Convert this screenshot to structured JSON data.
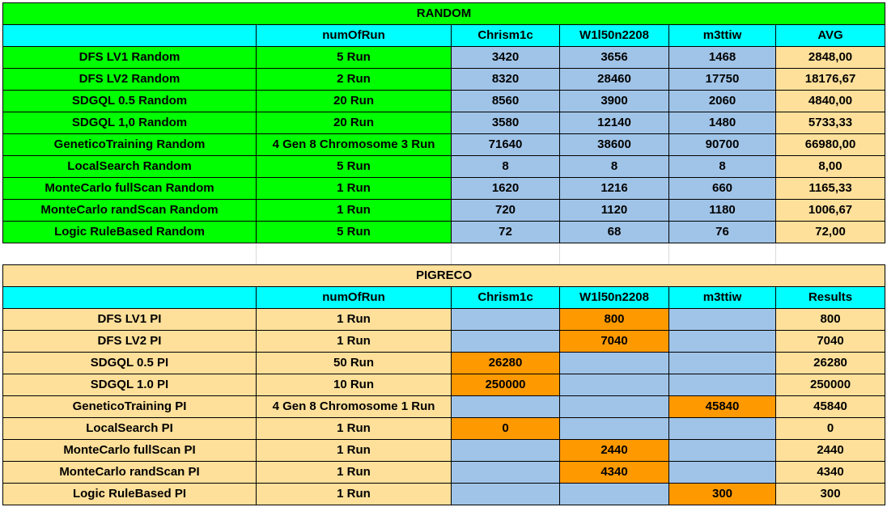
{
  "colors": {
    "green": "#00ff00",
    "cyan": "#00ffff",
    "blue": "#a0c4e8",
    "tan": "#ffe09a",
    "orange": "#ff9900"
  },
  "random": {
    "title": "RANDOM",
    "headers": [
      "",
      "numOfRun",
      "Chrism1c",
      "W1l50n2208",
      "m3ttiw",
      "AVG"
    ],
    "rows": [
      [
        "DFS LV1 Random",
        "5 Run",
        "3420",
        "3656",
        "1468",
        "2848,00"
      ],
      [
        "DFS LV2 Random",
        "2 Run",
        "8320",
        "28460",
        "17750",
        "18176,67"
      ],
      [
        "SDGQL 0.5 Random",
        "20 Run",
        "8560",
        "3900",
        "2060",
        "4840,00"
      ],
      [
        "SDGQL 1,0 Random",
        "20 Run",
        "3580",
        "12140",
        "1480",
        "5733,33"
      ],
      [
        "GeneticoTraining Random",
        "4 Gen 8 Chromosome 3 Run",
        "71640",
        "38600",
        "90700",
        "66980,00"
      ],
      [
        "LocalSearch Random",
        "5 Run",
        "8",
        "8",
        "8",
        "8,00"
      ],
      [
        "MonteCarlo fullScan Random",
        "1 Run",
        "1620",
        "1216",
        "660",
        "1165,33"
      ],
      [
        "MonteCarlo randScan Random",
        "1 Run",
        "720",
        "1120",
        "1180",
        "1006,67"
      ],
      [
        "Logic RuleBased Random",
        "5 Run",
        "72",
        "68",
        "76",
        "72,00"
      ]
    ]
  },
  "pigreco": {
    "title": "PIGRECO",
    "headers": [
      "",
      "numOfRun",
      "Chrism1c",
      "W1l50n2208",
      "m3ttiw",
      "Results"
    ],
    "rows": [
      [
        "DFS LV1 PI",
        "1 Run",
        "",
        "800",
        "",
        "800"
      ],
      [
        "DFS LV2 PI",
        "1 Run",
        "",
        "7040",
        "",
        "7040"
      ],
      [
        "SDGQL 0.5 PI",
        "50 Run",
        "26280",
        "",
        "",
        "26280"
      ],
      [
        "SDGQL 1.0 PI",
        "10 Run",
        "250000",
        "",
        "",
        "250000"
      ],
      [
        "GeneticoTraining PI",
        "4 Gen 8 Chromosome 1 Run",
        "",
        "",
        "45840",
        "45840"
      ],
      [
        "LocalSearch PI",
        "1 Run",
        "0",
        "",
        "",
        "0"
      ],
      [
        "MonteCarlo fullScan PI",
        "1 Run",
        "",
        "2440",
        "",
        "2440"
      ],
      [
        "MonteCarlo randScan PI",
        "1 Run",
        "",
        "4340",
        "",
        "4340"
      ],
      [
        "Logic RuleBased PI",
        "1 Run",
        "",
        "",
        "300",
        "300"
      ]
    ],
    "highlight_col": [
      3,
      3,
      2,
      2,
      4,
      2,
      3,
      3,
      4
    ]
  }
}
